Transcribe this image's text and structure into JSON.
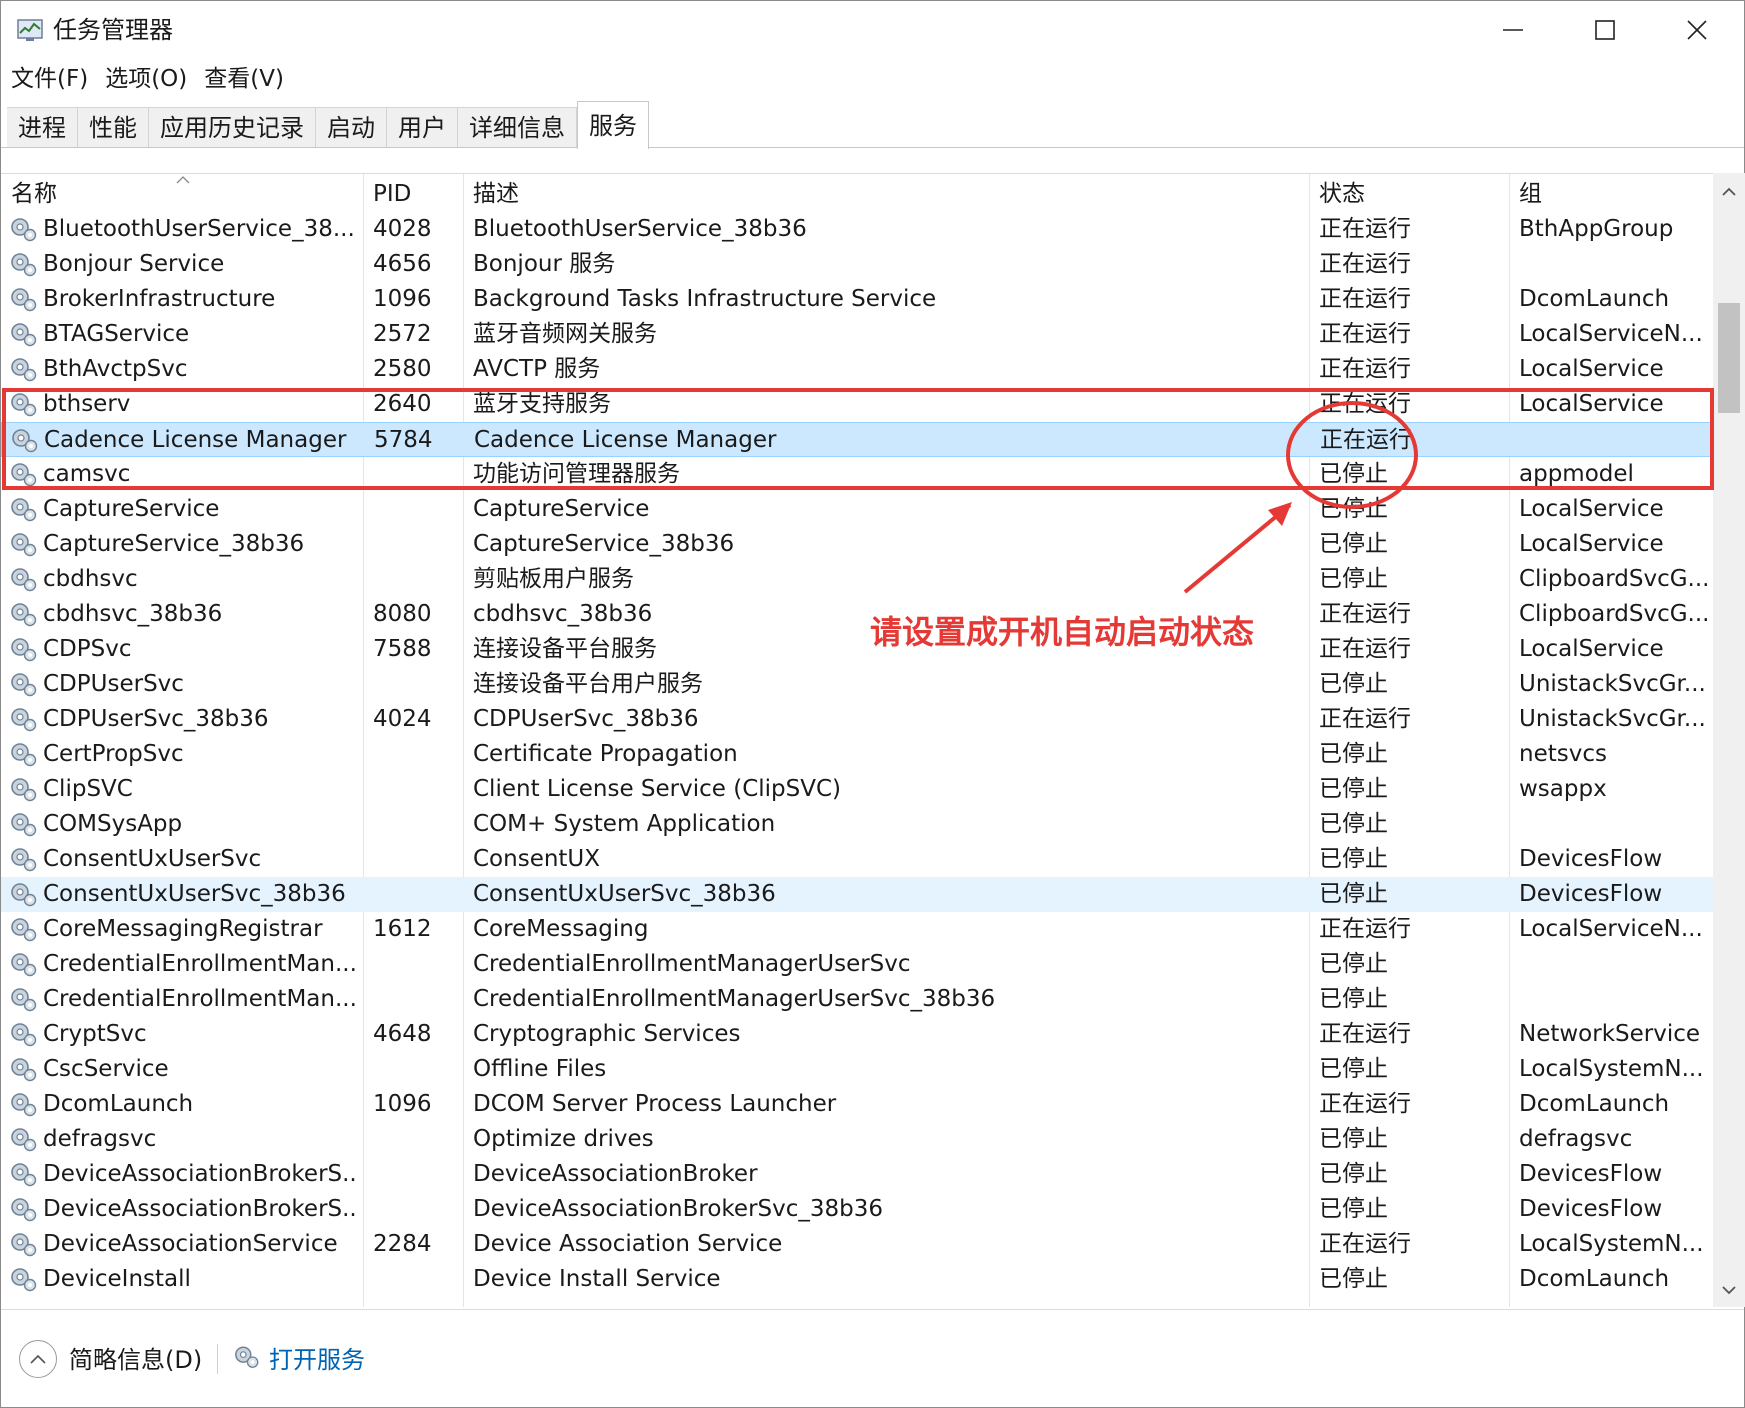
{
  "window": {
    "title": "任务管理器"
  },
  "menu": [
    {
      "label": "文件(F)"
    },
    {
      "label": "选项(O)"
    },
    {
      "label": "查看(V)"
    }
  ],
  "tabs": [
    {
      "label": "进程"
    },
    {
      "label": "性能"
    },
    {
      "label": "应用历史记录"
    },
    {
      "label": "启动"
    },
    {
      "label": "用户"
    },
    {
      "label": "详细信息"
    },
    {
      "label": "服务",
      "active": true
    }
  ],
  "table": {
    "columns": [
      "名称",
      "PID",
      "描述",
      "状态",
      "组"
    ],
    "sorted_column": "名称",
    "selected_row": "Cadence License Manager",
    "hover_row": "ConsentUxUserSvc_38b36",
    "rows": [
      {
        "name": "BluetoothUserService_38...",
        "pid": "4028",
        "desc": "BluetoothUserService_38b36",
        "status": "正在运行",
        "group": "BthAppGroup"
      },
      {
        "name": "Bonjour Service",
        "pid": "4656",
        "desc": "Bonjour 服务",
        "status": "正在运行",
        "group": ""
      },
      {
        "name": "BrokerInfrastructure",
        "pid": "1096",
        "desc": "Background Tasks Infrastructure Service",
        "status": "正在运行",
        "group": "DcomLaunch"
      },
      {
        "name": "BTAGService",
        "pid": "2572",
        "desc": "蓝牙音频网关服务",
        "status": "正在运行",
        "group": "LocalServiceN..."
      },
      {
        "name": "BthAvctpSvc",
        "pid": "2580",
        "desc": "AVCTP 服务",
        "status": "正在运行",
        "group": "LocalService"
      },
      {
        "name": "bthserv",
        "pid": "2640",
        "desc": "蓝牙支持服务",
        "status": "正在运行",
        "group": "LocalService"
      },
      {
        "name": "Cadence License Manager",
        "pid": "5784",
        "desc": "Cadence License Manager",
        "status": "正在运行",
        "group": ""
      },
      {
        "name": "camsvc",
        "pid": "",
        "desc": "功能访问管理器服务",
        "status": "已停止",
        "group": "appmodel"
      },
      {
        "name": "CaptureService",
        "pid": "",
        "desc": "CaptureService",
        "status": "已停止",
        "group": "LocalService"
      },
      {
        "name": "CaptureService_38b36",
        "pid": "",
        "desc": "CaptureService_38b36",
        "status": "已停止",
        "group": "LocalService"
      },
      {
        "name": "cbdhsvc",
        "pid": "",
        "desc": "剪贴板用户服务",
        "status": "已停止",
        "group": "ClipboardSvcG..."
      },
      {
        "name": "cbdhsvc_38b36",
        "pid": "8080",
        "desc": "cbdhsvc_38b36",
        "status": "正在运行",
        "group": "ClipboardSvcG..."
      },
      {
        "name": "CDPSvc",
        "pid": "7588",
        "desc": "连接设备平台服务",
        "status": "正在运行",
        "group": "LocalService"
      },
      {
        "name": "CDPUserSvc",
        "pid": "",
        "desc": "连接设备平台用户服务",
        "status": "已停止",
        "group": "UnistackSvcGr..."
      },
      {
        "name": "CDPUserSvc_38b36",
        "pid": "4024",
        "desc": "CDPUserSvc_38b36",
        "status": "正在运行",
        "group": "UnistackSvcGr..."
      },
      {
        "name": "CertPropSvc",
        "pid": "",
        "desc": "Certificate Propagation",
        "status": "已停止",
        "group": "netsvcs"
      },
      {
        "name": "ClipSVC",
        "pid": "",
        "desc": "Client License Service (ClipSVC)",
        "status": "已停止",
        "group": "wsappx"
      },
      {
        "name": "COMSysApp",
        "pid": "",
        "desc": "COM+ System Application",
        "status": "已停止",
        "group": ""
      },
      {
        "name": "ConsentUxUserSvc",
        "pid": "",
        "desc": "ConsentUX",
        "status": "已停止",
        "group": "DevicesFlow"
      },
      {
        "name": "ConsentUxUserSvc_38b36",
        "pid": "",
        "desc": "ConsentUxUserSvc_38b36",
        "status": "已停止",
        "group": "DevicesFlow"
      },
      {
        "name": "CoreMessagingRegistrar",
        "pid": "1612",
        "desc": "CoreMessaging",
        "status": "正在运行",
        "group": "LocalServiceN..."
      },
      {
        "name": "CredentialEnrollmentMan...",
        "pid": "",
        "desc": "CredentialEnrollmentManagerUserSvc",
        "status": "已停止",
        "group": ""
      },
      {
        "name": "CredentialEnrollmentMan...",
        "pid": "",
        "desc": "CredentialEnrollmentManagerUserSvc_38b36",
        "status": "已停止",
        "group": ""
      },
      {
        "name": "CryptSvc",
        "pid": "4648",
        "desc": "Cryptographic Services",
        "status": "正在运行",
        "group": "NetworkService"
      },
      {
        "name": "CscService",
        "pid": "",
        "desc": "Offline Files",
        "status": "已停止",
        "group": "LocalSystemN..."
      },
      {
        "name": "DcomLaunch",
        "pid": "1096",
        "desc": "DCOM Server Process Launcher",
        "status": "正在运行",
        "group": "DcomLaunch"
      },
      {
        "name": "defragsvc",
        "pid": "",
        "desc": "Optimize drives",
        "status": "已停止",
        "group": "defragsvc"
      },
      {
        "name": "DeviceAssociationBrokerS...",
        "pid": "",
        "desc": "DeviceAssociationBroker",
        "status": "已停止",
        "group": "DevicesFlow"
      },
      {
        "name": "DeviceAssociationBrokerS...",
        "pid": "",
        "desc": "DeviceAssociationBrokerSvc_38b36",
        "status": "已停止",
        "group": "DevicesFlow"
      },
      {
        "name": "DeviceAssociationService",
        "pid": "2284",
        "desc": "Device Association Service",
        "status": "正在运行",
        "group": "LocalSystemN..."
      },
      {
        "name": "DeviceInstall",
        "pid": "",
        "desc": "Device Install Service",
        "status": "已停止",
        "group": "DcomLaunch"
      }
    ]
  },
  "footer": {
    "fewer_details": "简略信息(D)",
    "open_services": "打开服务"
  },
  "annotation": {
    "text": "请设置成开机自动启动状态",
    "color": "#e53935"
  },
  "colors": {
    "selected_row": "#cce8ff",
    "hover_row": "#e5f3ff",
    "link": "#0063b1"
  },
  "icons": {
    "app": "task-manager-icon",
    "service": "gear-service-icon",
    "minimize": "minimize-icon",
    "maximize": "maximize-icon",
    "close": "close-icon"
  }
}
